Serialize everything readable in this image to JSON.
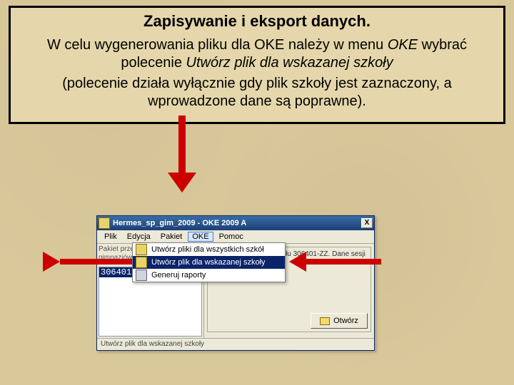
{
  "callout": {
    "title": "Zapisywanie i eksport danych.",
    "p1_a": "W celu wygenerowania pliku dla OKE należy w menu ",
    "p1_i1": "OKE",
    "p1_b": " wybrać polecenie ",
    "p1_i2": "Utwórz plik dla wskazanej szkoły",
    "p2": "(polecenie działa wyłącznie gdy plik szkoły jest zaznaczony, a wprowadzone dane są poprawne)."
  },
  "app": {
    "title": "Hermes_sp_gim_2009 - OKE 2009 A",
    "close": "X",
    "menu": [
      "Plik",
      "Edycja",
      "Pakiet",
      "OKE",
      "Pomoc"
    ],
    "active_menu_index": 3,
    "dropdown": [
      "Utwórz pliki dla wszystkich szkół",
      "Utwórz plik dla wskazanej szkoły",
      "Generuj raporty"
    ],
    "dropdown_hl_index": 1,
    "left_desc": "Pakiet przeznaczony dla gimnazjów do sprawdz…",
    "file_selected": "306401-ZZGZX",
    "group_text": "Szkoła należy do zespołu 306401-ZZ. Dane sesji wiosna/lato 2009.",
    "open_label": "Otwórz",
    "status": "Utwórz plik dla wskazanej szkoły"
  }
}
